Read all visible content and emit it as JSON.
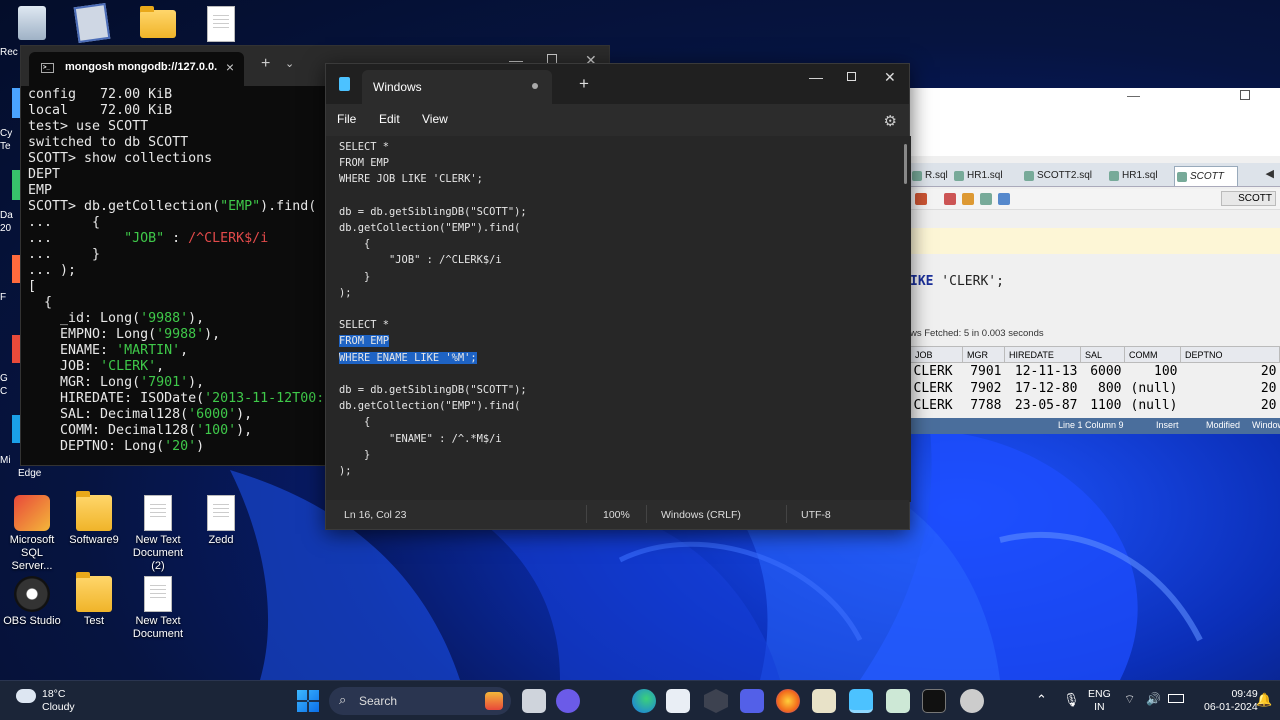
{
  "desktop": {
    "icons": [
      {
        "label": "Microsoft SQL Server...",
        "icon": "database-bag-icon"
      },
      {
        "label": "Software9",
        "icon": "folder-icon"
      },
      {
        "label": "New Text Document (2)",
        "icon": "text-file-icon"
      },
      {
        "label": "Zedd",
        "icon": "text-file-icon"
      },
      {
        "label": "OBS Studio",
        "icon": "obs-icon"
      },
      {
        "label": "Test",
        "icon": "folder-icon"
      },
      {
        "label": "New Text Document",
        "icon": "text-file-icon"
      }
    ],
    "clipped_labels": [
      "Rec",
      "Cy",
      "Te",
      "Da",
      "20",
      "F",
      "G",
      "C",
      "Mi",
      "Edge"
    ]
  },
  "terminal": {
    "tab_title": "mongosh mongodb://127.0.0.",
    "new_tab": "+",
    "dropdown": "⌄",
    "lines": [
      {
        "segments": [
          {
            "t": "config   72.00 KiB"
          }
        ]
      },
      {
        "segments": [
          {
            "t": "local    72.00 KiB"
          }
        ]
      },
      {
        "segments": [
          {
            "t": "test> use SCOTT"
          }
        ]
      },
      {
        "segments": [
          {
            "t": "switched to db SCOTT"
          }
        ]
      },
      {
        "segments": [
          {
            "t": "SCOTT> show collections"
          }
        ]
      },
      {
        "segments": [
          {
            "t": "DEPT"
          }
        ]
      },
      {
        "segments": [
          {
            "t": "EMP"
          }
        ]
      },
      {
        "segments": [
          {
            "t": "SCOTT> db.getCollection("
          },
          {
            "t": "\"EMP\"",
            "c": "g"
          },
          {
            "t": ").find("
          }
        ]
      },
      {
        "segments": [
          {
            "t": "...     {"
          }
        ]
      },
      {
        "segments": [
          {
            "t": "...         "
          },
          {
            "t": "\"JOB\"",
            "c": "g"
          },
          {
            "t": " : "
          },
          {
            "t": "/^CLERK$/i",
            "c": "r"
          }
        ]
      },
      {
        "segments": [
          {
            "t": "...     }"
          }
        ]
      },
      {
        "segments": [
          {
            "t": "... );"
          }
        ]
      },
      {
        "segments": [
          {
            "t": "["
          }
        ]
      },
      {
        "segments": [
          {
            "t": "  {"
          }
        ]
      },
      {
        "segments": [
          {
            "t": "    _id: Long("
          },
          {
            "t": "'9988'",
            "c": "g"
          },
          {
            "t": "),"
          }
        ]
      },
      {
        "segments": [
          {
            "t": "    EMPNO: Long("
          },
          {
            "t": "'9988'",
            "c": "g"
          },
          {
            "t": "),"
          }
        ]
      },
      {
        "segments": [
          {
            "t": "    ENAME: "
          },
          {
            "t": "'MARTIN'",
            "c": "g"
          },
          {
            "t": ","
          }
        ]
      },
      {
        "segments": [
          {
            "t": "    JOB: "
          },
          {
            "t": "'CLERK'",
            "c": "g"
          },
          {
            "t": ","
          }
        ]
      },
      {
        "segments": [
          {
            "t": "    MGR: Long("
          },
          {
            "t": "'7901'",
            "c": "g"
          },
          {
            "t": "),"
          }
        ]
      },
      {
        "segments": [
          {
            "t": "    HIREDATE: ISODate("
          },
          {
            "t": "'2013-11-12T00:0",
            "c": "g"
          }
        ]
      },
      {
        "segments": [
          {
            "t": "    SAL: Decimal128("
          },
          {
            "t": "'6000'",
            "c": "g"
          },
          {
            "t": "),"
          }
        ]
      },
      {
        "segments": [
          {
            "t": "    COMM: Decimal128("
          },
          {
            "t": "'100'",
            "c": "g"
          },
          {
            "t": "),"
          }
        ]
      },
      {
        "segments": [
          {
            "t": "    DEPTNO: Long("
          },
          {
            "t": "'20'",
            "c": "g"
          },
          {
            "t": ")"
          }
        ]
      }
    ]
  },
  "notepad": {
    "tab_title": "Windows",
    "new_tab": "+",
    "menu": [
      "File",
      "Edit",
      "View"
    ],
    "lines": [
      {
        "text": "SELECT *"
      },
      {
        "text": "FROM EMP"
      },
      {
        "text": "WHERE JOB LIKE 'CLERK';"
      },
      {
        "text": ""
      },
      {
        "text": "db = db.getSiblingDB(\"SCOTT\");"
      },
      {
        "text": "db.getCollection(\"EMP\").find("
      },
      {
        "text": "    {"
      },
      {
        "text": "        \"JOB\" : /^CLERK$/i"
      },
      {
        "text": "    }"
      },
      {
        "text": ");"
      },
      {
        "text": ""
      },
      {
        "text": "SELECT *"
      },
      {
        "text": "FROM EMP",
        "selected": true
      },
      {
        "text": "WHERE ENAME LIKE '%M';",
        "selected": true
      },
      {
        "text": ""
      },
      {
        "text": "db = db.getSiblingDB(\"SCOTT\");"
      },
      {
        "text": "db.getCollection(\"EMP\").find("
      },
      {
        "text": "    {"
      },
      {
        "text": "        \"ENAME\" : /^.*M$/i"
      },
      {
        "text": "    }"
      },
      {
        "text": ");"
      }
    ],
    "status": {
      "position": "Ln 16, Col 23",
      "zoom": "100%",
      "line_ending": "Windows (CRLF)",
      "encoding": "UTF-8"
    }
  },
  "sql_developer": {
    "tabs": [
      "R.sql",
      "HR1.sql",
      "SCOTT2.sql",
      "HR1.sql",
      "SCOTT"
    ],
    "connection": "SCOTT",
    "code_keyword": "IKE",
    "code_rest": " 'CLERK';",
    "fetch_info": "ws Fetched: 5 in 0.003 seconds",
    "columns": [
      "JOB",
      "MGR",
      "HIREDATE",
      "SAL",
      "COMM",
      "DEPTNO"
    ],
    "rows": [
      [
        "CLERK",
        "7901",
        "12-11-13",
        "6000",
        "100",
        "20"
      ],
      [
        "CLERK",
        "7902",
        "17-12-80",
        "800",
        "(null)",
        "20"
      ],
      [
        "CLERK",
        "7788",
        "23-05-87",
        "1100",
        "(null)",
        "20"
      ]
    ],
    "status_line": "Line 1 Column 9",
    "status_insert": "Insert",
    "status_modified": "Modified",
    "status_end": "Window"
  },
  "taskbar": {
    "weather_temp": "18°C",
    "weather_desc": "Cloudy",
    "search": "Search",
    "lang_1": "ENG",
    "lang_2": "IN",
    "time": "09:49",
    "date": "06-01-2024"
  }
}
